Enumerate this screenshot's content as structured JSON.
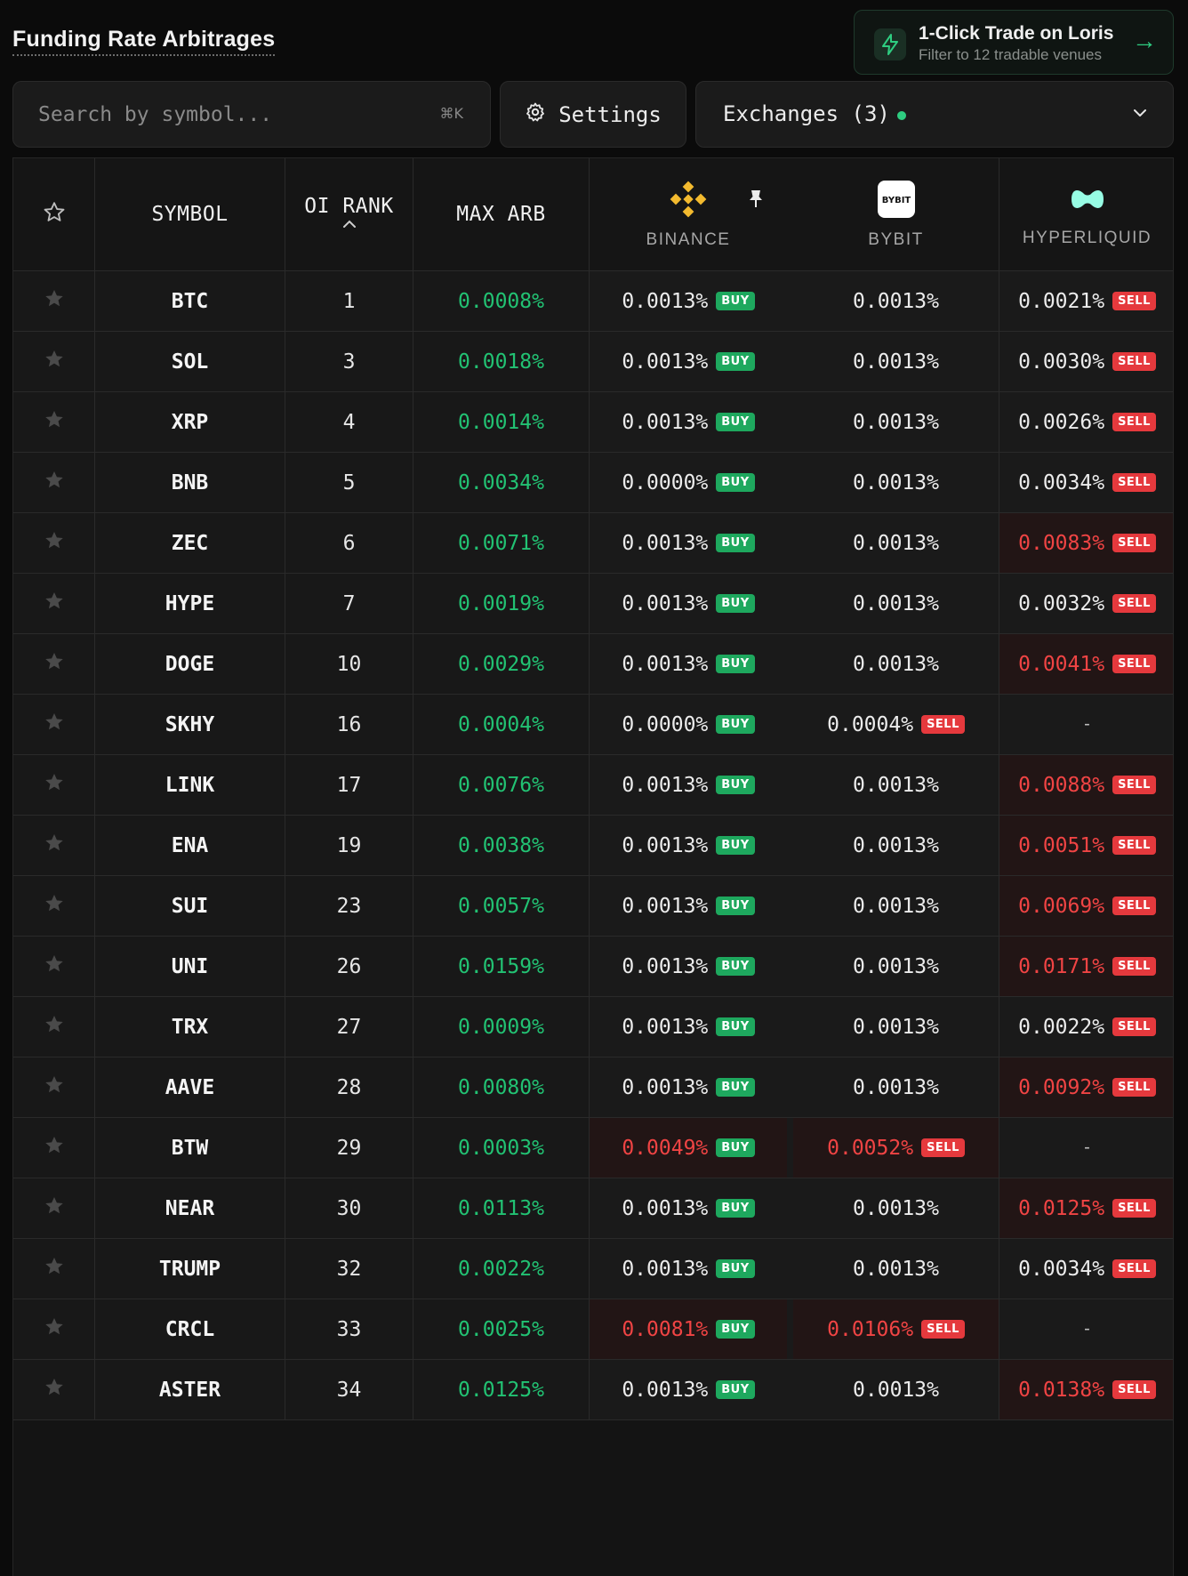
{
  "header": {
    "title": "Funding Rate Arbitrages",
    "promo_title": "1-Click Trade on Loris",
    "promo_subtitle": "Filter to 12 tradable venues",
    "promo_arrow": "→"
  },
  "toolbar": {
    "search_placeholder": "Search by symbol...",
    "search_shortcut": "⌘K",
    "settings_label": "Settings",
    "exchanges_label": "Exchanges (3)"
  },
  "columns": {
    "symbol": "SYMBOL",
    "oi_rank": "OI RANK",
    "max_arb": "MAX ARB",
    "binance": "BINANCE",
    "bybit": "BYBIT",
    "bybit_logo": "BYBIT",
    "hyperliquid": "HYPERLIQUID"
  },
  "labels": {
    "buy": "BUY",
    "sell": "SELL"
  },
  "colors": {
    "accent": "#2ecc80",
    "buy": "#1ea85e",
    "sell": "#e5393d",
    "positive": "#22c273",
    "negative": "#f04444",
    "binance": "#f3ba2f",
    "hyperliquid": "#97fce4"
  },
  "rows": [
    {
      "symbol": "BTC",
      "rank": "1",
      "max_arb": "0.0008%",
      "binance": "0.0013%",
      "binance_side": "buy",
      "binance_hot": false,
      "bybit": "0.0013%",
      "bybit_side": "",
      "bybit_hot": false,
      "hyper": "0.0021%",
      "hyper_side": "sell",
      "hyper_hot": false
    },
    {
      "symbol": "SOL",
      "rank": "3",
      "max_arb": "0.0018%",
      "binance": "0.0013%",
      "binance_side": "buy",
      "binance_hot": false,
      "bybit": "0.0013%",
      "bybit_side": "",
      "bybit_hot": false,
      "hyper": "0.0030%",
      "hyper_side": "sell",
      "hyper_hot": false
    },
    {
      "symbol": "XRP",
      "rank": "4",
      "max_arb": "0.0014%",
      "binance": "0.0013%",
      "binance_side": "buy",
      "binance_hot": false,
      "bybit": "0.0013%",
      "bybit_side": "",
      "bybit_hot": false,
      "hyper": "0.0026%",
      "hyper_side": "sell",
      "hyper_hot": false
    },
    {
      "symbol": "BNB",
      "rank": "5",
      "max_arb": "0.0034%",
      "binance": "0.0000%",
      "binance_side": "buy",
      "binance_hot": false,
      "bybit": "0.0013%",
      "bybit_side": "",
      "bybit_hot": false,
      "hyper": "0.0034%",
      "hyper_side": "sell",
      "hyper_hot": false
    },
    {
      "symbol": "ZEC",
      "rank": "6",
      "max_arb": "0.0071%",
      "binance": "0.0013%",
      "binance_side": "buy",
      "binance_hot": false,
      "bybit": "0.0013%",
      "bybit_side": "",
      "bybit_hot": false,
      "hyper": "0.0083%",
      "hyper_side": "sell",
      "hyper_hot": true
    },
    {
      "symbol": "HYPE",
      "rank": "7",
      "max_arb": "0.0019%",
      "binance": "0.0013%",
      "binance_side": "buy",
      "binance_hot": false,
      "bybit": "0.0013%",
      "bybit_side": "",
      "bybit_hot": false,
      "hyper": "0.0032%",
      "hyper_side": "sell",
      "hyper_hot": false
    },
    {
      "symbol": "DOGE",
      "rank": "10",
      "max_arb": "0.0029%",
      "binance": "0.0013%",
      "binance_side": "buy",
      "binance_hot": false,
      "bybit": "0.0013%",
      "bybit_side": "",
      "bybit_hot": false,
      "hyper": "0.0041%",
      "hyper_side": "sell",
      "hyper_hot": true
    },
    {
      "symbol": "SKHY",
      "rank": "16",
      "max_arb": "0.0004%",
      "binance": "0.0000%",
      "binance_side": "buy",
      "binance_hot": false,
      "bybit": "0.0004%",
      "bybit_side": "sell",
      "bybit_hot": false,
      "hyper": "-",
      "hyper_side": "",
      "hyper_hot": false
    },
    {
      "symbol": "LINK",
      "rank": "17",
      "max_arb": "0.0076%",
      "binance": "0.0013%",
      "binance_side": "buy",
      "binance_hot": false,
      "bybit": "0.0013%",
      "bybit_side": "",
      "bybit_hot": false,
      "hyper": "0.0088%",
      "hyper_side": "sell",
      "hyper_hot": true
    },
    {
      "symbol": "ENA",
      "rank": "19",
      "max_arb": "0.0038%",
      "binance": "0.0013%",
      "binance_side": "buy",
      "binance_hot": false,
      "bybit": "0.0013%",
      "bybit_side": "",
      "bybit_hot": false,
      "hyper": "0.0051%",
      "hyper_side": "sell",
      "hyper_hot": true
    },
    {
      "symbol": "SUI",
      "rank": "23",
      "max_arb": "0.0057%",
      "binance": "0.0013%",
      "binance_side": "buy",
      "binance_hot": false,
      "bybit": "0.0013%",
      "bybit_side": "",
      "bybit_hot": false,
      "hyper": "0.0069%",
      "hyper_side": "sell",
      "hyper_hot": true
    },
    {
      "symbol": "UNI",
      "rank": "26",
      "max_arb": "0.0159%",
      "binance": "0.0013%",
      "binance_side": "buy",
      "binance_hot": false,
      "bybit": "0.0013%",
      "bybit_side": "",
      "bybit_hot": false,
      "hyper": "0.0171%",
      "hyper_side": "sell",
      "hyper_hot": true
    },
    {
      "symbol": "TRX",
      "rank": "27",
      "max_arb": "0.0009%",
      "binance": "0.0013%",
      "binance_side": "buy",
      "binance_hot": false,
      "bybit": "0.0013%",
      "bybit_side": "",
      "bybit_hot": false,
      "hyper": "0.0022%",
      "hyper_side": "sell",
      "hyper_hot": false
    },
    {
      "symbol": "AAVE",
      "rank": "28",
      "max_arb": "0.0080%",
      "binance": "0.0013%",
      "binance_side": "buy",
      "binance_hot": false,
      "bybit": "0.0013%",
      "bybit_side": "",
      "bybit_hot": false,
      "hyper": "0.0092%",
      "hyper_side": "sell",
      "hyper_hot": true
    },
    {
      "symbol": "BTW",
      "rank": "29",
      "max_arb": "0.0003%",
      "binance": "0.0049%",
      "binance_side": "buy",
      "binance_hot": true,
      "bybit": "0.0052%",
      "bybit_side": "sell",
      "bybit_hot": true,
      "hyper": "-",
      "hyper_side": "",
      "hyper_hot": false
    },
    {
      "symbol": "NEAR",
      "rank": "30",
      "max_arb": "0.0113%",
      "binance": "0.0013%",
      "binance_side": "buy",
      "binance_hot": false,
      "bybit": "0.0013%",
      "bybit_side": "",
      "bybit_hot": false,
      "hyper": "0.0125%",
      "hyper_side": "sell",
      "hyper_hot": true
    },
    {
      "symbol": "TRUMP",
      "rank": "32",
      "max_arb": "0.0022%",
      "binance": "0.0013%",
      "binance_side": "buy",
      "binance_hot": false,
      "bybit": "0.0013%",
      "bybit_side": "",
      "bybit_hot": false,
      "hyper": "0.0034%",
      "hyper_side": "sell",
      "hyper_hot": false
    },
    {
      "symbol": "CRCL",
      "rank": "33",
      "max_arb": "0.0025%",
      "binance": "0.0081%",
      "binance_side": "buy",
      "binance_hot": true,
      "bybit": "0.0106%",
      "bybit_side": "sell",
      "bybit_hot": true,
      "hyper": "-",
      "hyper_side": "",
      "hyper_hot": false
    },
    {
      "symbol": "ASTER",
      "rank": "34",
      "max_arb": "0.0125%",
      "binance": "0.0013%",
      "binance_side": "buy",
      "binance_hot": false,
      "bybit": "0.0013%",
      "bybit_side": "",
      "bybit_hot": false,
      "hyper": "0.0138%",
      "hyper_side": "sell",
      "hyper_hot": true
    }
  ]
}
